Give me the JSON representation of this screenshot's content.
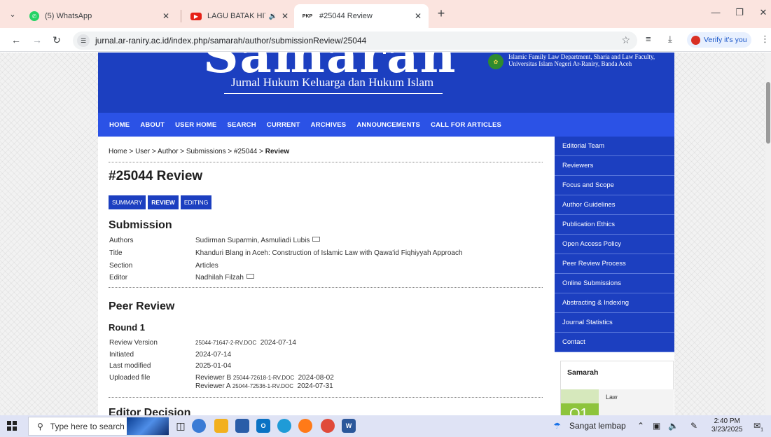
{
  "browser": {
    "tabs": [
      {
        "title": "(5) WhatsApp",
        "icon": "whatsapp-icon"
      },
      {
        "title": "LAGU BATAK HITS SOUND",
        "icon": "youtube-icon",
        "audio": "🔉"
      },
      {
        "title": "#25044 Review",
        "icon": "pkp-icon",
        "favicon_text": "PKP",
        "active": true
      }
    ],
    "new_tab": "+",
    "url": "jurnal.ar-raniry.ac.id/index.php/samarah/author/submissionReview/25044",
    "profile_label": "Verify it's you"
  },
  "header": {
    "logo_text": "Samarah",
    "subtitle": "Jurnal Hukum Keluarga dan Hukum Islam",
    "university_line1": "Islamic Family Law Department, Sharia and Law Faculty,",
    "university_line2": "Universitas Islam Negeri Ar-Raniry, Banda Aceh"
  },
  "nav": [
    "HOME",
    "ABOUT",
    "USER HOME",
    "SEARCH",
    "CURRENT",
    "ARCHIVES",
    "ANNOUNCEMENTS",
    "CALL FOR ARTICLES"
  ],
  "breadcrumb": {
    "trail": "Home > User > Author > Submissions > #25044 > ",
    "current": "Review"
  },
  "page_title": "#25044 Review",
  "subtabs": [
    "SUMMARY",
    "REVIEW",
    "EDITING"
  ],
  "submission": {
    "heading": "Submission",
    "authors_label": "Authors",
    "authors": "Sudirman Suparmin, Asmuliadi Lubis",
    "title_label": "Title",
    "title": "Khanduri Blang in Aceh: Construction of Islamic Law with Qawa'id Fiqhiyyah Approach",
    "section_label": "Section",
    "section": "Articles",
    "editor_label": "Editor",
    "editor": "Nadhilah Filzah"
  },
  "peer_review": {
    "heading": "Peer Review",
    "round": "Round 1",
    "review_version_label": "Review Version",
    "review_version_file": "25044-71647-2-RV.DOC",
    "review_version_date": "2024-07-14",
    "initiated_label": "Initiated",
    "initiated": "2024-07-14",
    "last_modified_label": "Last modified",
    "last_modified": "2025-01-04",
    "uploaded_label": "Uploaded file",
    "uploads": [
      {
        "reviewer": "Reviewer B",
        "file": "25044-72618-1-RV.DOC",
        "date": "2024-08-02"
      },
      {
        "reviewer": "Reviewer A",
        "file": "25044-72536-1-RV.DOC",
        "date": "2024-07-31"
      }
    ]
  },
  "editor_decision": "Editor Decision",
  "sidebar": [
    "Editorial Team",
    "Reviewers",
    "Focus and Scope",
    "Author Guidelines",
    "Publication Ethics",
    "Open Access Policy",
    "Peer Review Process",
    "Online Submissions",
    "Abstracting & Indexing",
    "Journal Statistics",
    "Contact"
  ],
  "sidebar_card": {
    "title": "Samarah",
    "quartile": "Q1",
    "category": "Law"
  },
  "taskbar": {
    "search_placeholder": "Type here to search",
    "weather": "Sangat lembap",
    "time": "2:40 PM",
    "date": "3/23/2025",
    "notifications": "1"
  },
  "colors": {
    "header_blue": "#1c3fc0",
    "nav_blue": "#2b52e6",
    "tabstrip": "#fbe4df"
  }
}
